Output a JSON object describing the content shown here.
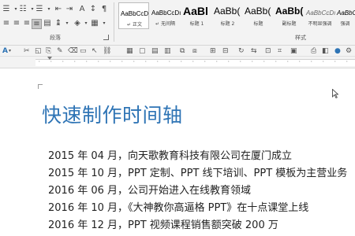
{
  "ribbon": {
    "paragraph_group_label": "段落",
    "styles_group_label": "样式",
    "styles": [
      {
        "sample": "AaBbCcDı",
        "name": "↵ 正文"
      },
      {
        "sample": "AaBbCcDı",
        "name": "↵ 无间隔"
      },
      {
        "sample": "AaBl",
        "name": "标题 1"
      },
      {
        "sample": "AaBb(",
        "name": "标题 2"
      },
      {
        "sample": "AaBb(",
        "name": "标题"
      },
      {
        "sample": "AaBb(",
        "name": "副标题"
      },
      {
        "sample": "AaBbCcDı",
        "name": "不明显强调"
      },
      {
        "sample": "AaBbCı",
        "name": "强调"
      }
    ]
  },
  "document": {
    "title": "快速制作时间轴",
    "lines": [
      "2015 年 04 月，向天歌教育科技有限公司在厦门成立",
      "2015 年 10 月，PPT 定制、PPT 线下培训、PPT 模板为主营业务",
      "2016 年 06 月，公司开始进入在线教育领域",
      "2016 年 10 月，《大神教你高逼格 PPT》在十点课堂上线",
      "2016 年 12 月，PPT 视频课程销售额突破 200 万"
    ]
  },
  "colors": {
    "title": "#2e74b5",
    "ribbon_bg": "#f3f3f3",
    "body_text": "#222222"
  }
}
